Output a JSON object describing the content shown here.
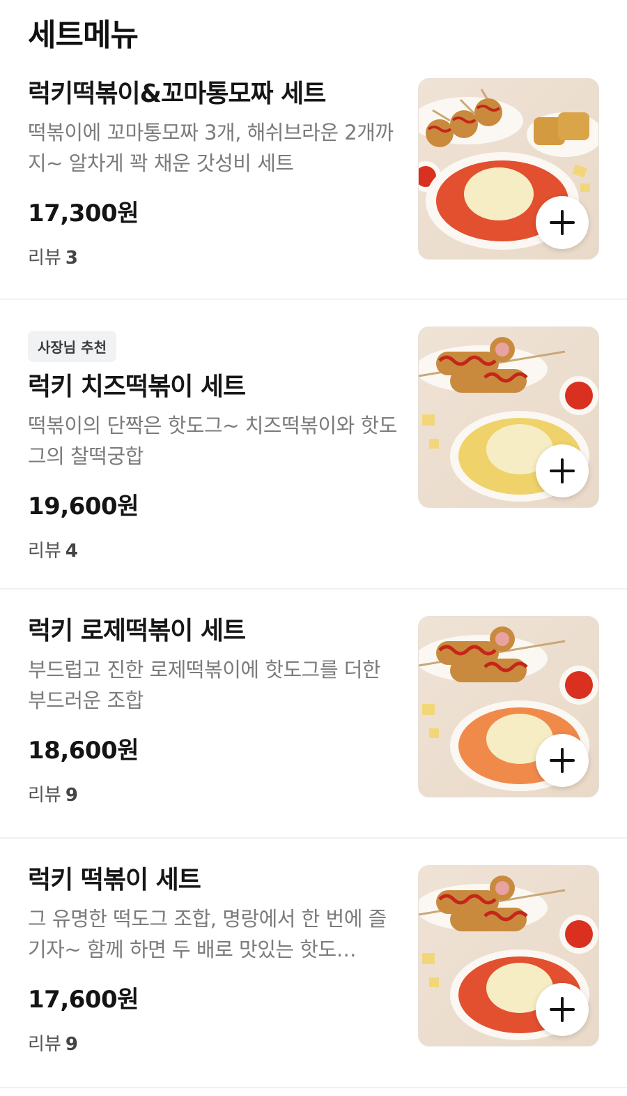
{
  "section": {
    "title": "세트메뉴"
  },
  "items": [
    {
      "badge": "",
      "name": "럭키떡볶이&꼬마통모짜 세트",
      "description": "떡볶이에 꼬마통모짜 3개, 해쉬브라운 2개까지~ 알차게 꽉 채운 갓성비 세트",
      "price": "17,300원",
      "review_label": "리뷰",
      "review_count": "3",
      "image_icon": "tteokbokki-set-image",
      "add_icon": "plus-icon"
    },
    {
      "badge": "사장님 추천",
      "name": "럭키 치즈떡볶이 세트",
      "description": "떡볶이의 단짝은 핫도그~ 치즈떡볶이와 핫도그의 찰떡궁합",
      "price": "19,600원",
      "review_label": "리뷰",
      "review_count": "4",
      "image_icon": "cheese-tteokbokki-set-image",
      "add_icon": "plus-icon"
    },
    {
      "badge": "",
      "name": "럭키 로제떡볶이 세트",
      "description": "부드럽고 진한 로제떡볶이에 핫도그를 더한 부드러운 조합",
      "price": "18,600원",
      "review_label": "리뷰",
      "review_count": "9",
      "image_icon": "rose-tteokbokki-set-image",
      "add_icon": "plus-icon"
    },
    {
      "badge": "",
      "name": "럭키 떡볶이 세트",
      "description": "그 유명한 떡도그 조합, 명랑에서 한 번에 즐기자~ 함께 하면 두 배로 맛있는 핫도…",
      "price": "17,600원",
      "review_label": "리뷰",
      "review_count": "9",
      "image_icon": "tteokbokki-set-image",
      "add_icon": "plus-icon"
    }
  ],
  "colors": {
    "sauce_red": "#e2502f",
    "rose_orange": "#f08a4b",
    "cheese": "#f6edc4",
    "plate": "#fbf8f3",
    "background": "#ede0d2"
  }
}
